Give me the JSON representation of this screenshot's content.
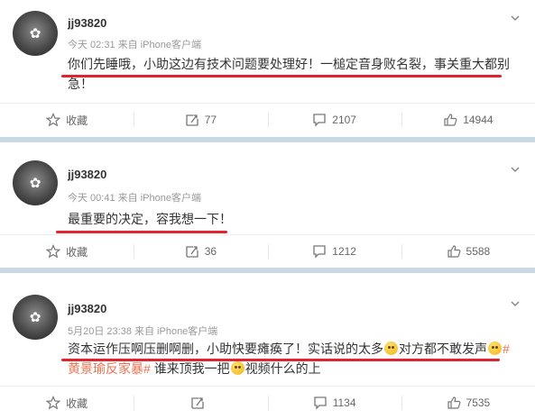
{
  "posts": [
    {
      "username": "jj93820",
      "meta": "今天 02:31 来自 iPhone客户端",
      "text_line1": "你们先睡哦，小助这边有技术问题要处理好！一槌定音身败名裂，事关重大都别",
      "text_line2": "急！",
      "actions": {
        "fav": "收藏",
        "repost": "77",
        "comment": "2107",
        "like": "14944"
      }
    },
    {
      "username": "jj93820",
      "meta": "今天 00:41 来自 iPhone客户端",
      "text_line1": "最重要的决定，容我想一下！",
      "actions": {
        "fav": "收藏",
        "repost": "36",
        "comment": "1212",
        "like": "5588"
      }
    },
    {
      "username": "jj93820",
      "meta": "5月20日 23:38 来自 iPhone客户端",
      "text_seg1": "资本运作压啊压删啊删，小助快要瘫痪了！实话说的太多",
      "text_seg2": "对方都不敢发声",
      "text_tag_hash": "#",
      "text_tag": "黄景瑜反家暴#",
      "text_seg3": "谁来顶我一把",
      "text_seg4": "视频什么的上",
      "actions": {
        "fav": "收藏",
        "repost": "",
        "comment": "1134",
        "like": "7535"
      }
    }
  ],
  "colors": {
    "accent": "#e0232e",
    "separator": "#c9d9e4",
    "tag": "#eb7350"
  },
  "icons": [
    "chevron-down-icon",
    "star-icon",
    "repost-icon",
    "comment-icon",
    "like-icon",
    "emoji-icon"
  ]
}
